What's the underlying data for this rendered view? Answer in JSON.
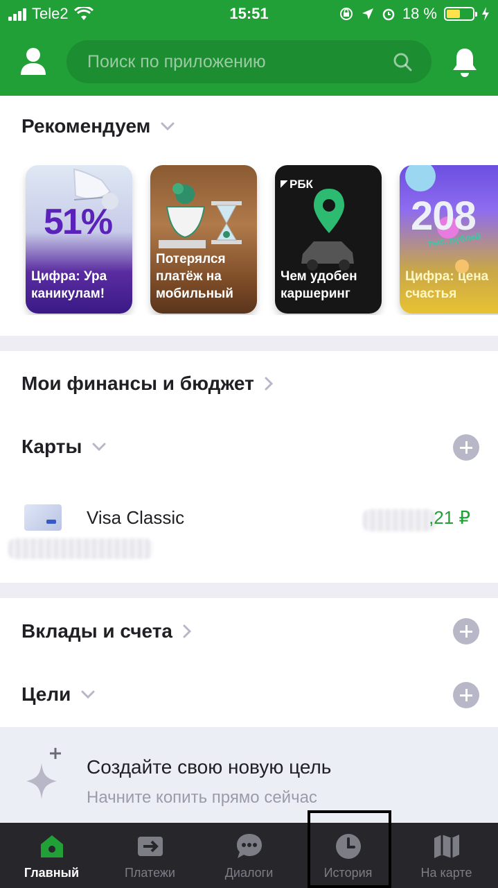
{
  "status_bar": {
    "carrier": "Tele2",
    "time": "15:51",
    "battery": "18 %",
    "battery_level": 0.18
  },
  "header": {
    "search_placeholder": "Поиск по приложению",
    "icons": [
      "profile-icon",
      "search-icon",
      "bell-icon"
    ]
  },
  "recommend": {
    "title": "Рекомендуем",
    "stories": [
      {
        "caption": "Цифра: Ура каникулам!",
        "badge": "51%"
      },
      {
        "caption": "Потерялся платёж на мобильный"
      },
      {
        "caption": "Чем удобен каршеринг",
        "brand": "РБК"
      },
      {
        "caption": "Цифра: цена счастья",
        "badge": "208",
        "badge_sub": "тыс. рублей"
      }
    ]
  },
  "finance": {
    "title": "Мои финансы и бюджет"
  },
  "cards": {
    "title": "Карты",
    "items": [
      {
        "name": "Visa Classic",
        "amount": ",21 ₽"
      }
    ]
  },
  "deposits": {
    "title": "Вклады и счета"
  },
  "goals": {
    "title": "Цели",
    "promo_title": "Создайте свою новую цель",
    "promo_subtitle": "Начните копить прямо сейчас"
  },
  "tabbar": {
    "tabs": [
      {
        "label": "Главный",
        "icon": "home-icon",
        "active": true
      },
      {
        "label": "Платежи",
        "icon": "payments-icon",
        "active": false
      },
      {
        "label": "Диалоги",
        "icon": "chat-icon",
        "active": false
      },
      {
        "label": "История",
        "icon": "clock-icon",
        "active": false
      },
      {
        "label": "На карте",
        "icon": "map-icon",
        "active": false
      }
    ]
  },
  "colors": {
    "brand_green": "#21a038",
    "tabbar_bg": "#26262b",
    "plus_button": "#b7b7c8",
    "amount_green": "#21a038"
  }
}
